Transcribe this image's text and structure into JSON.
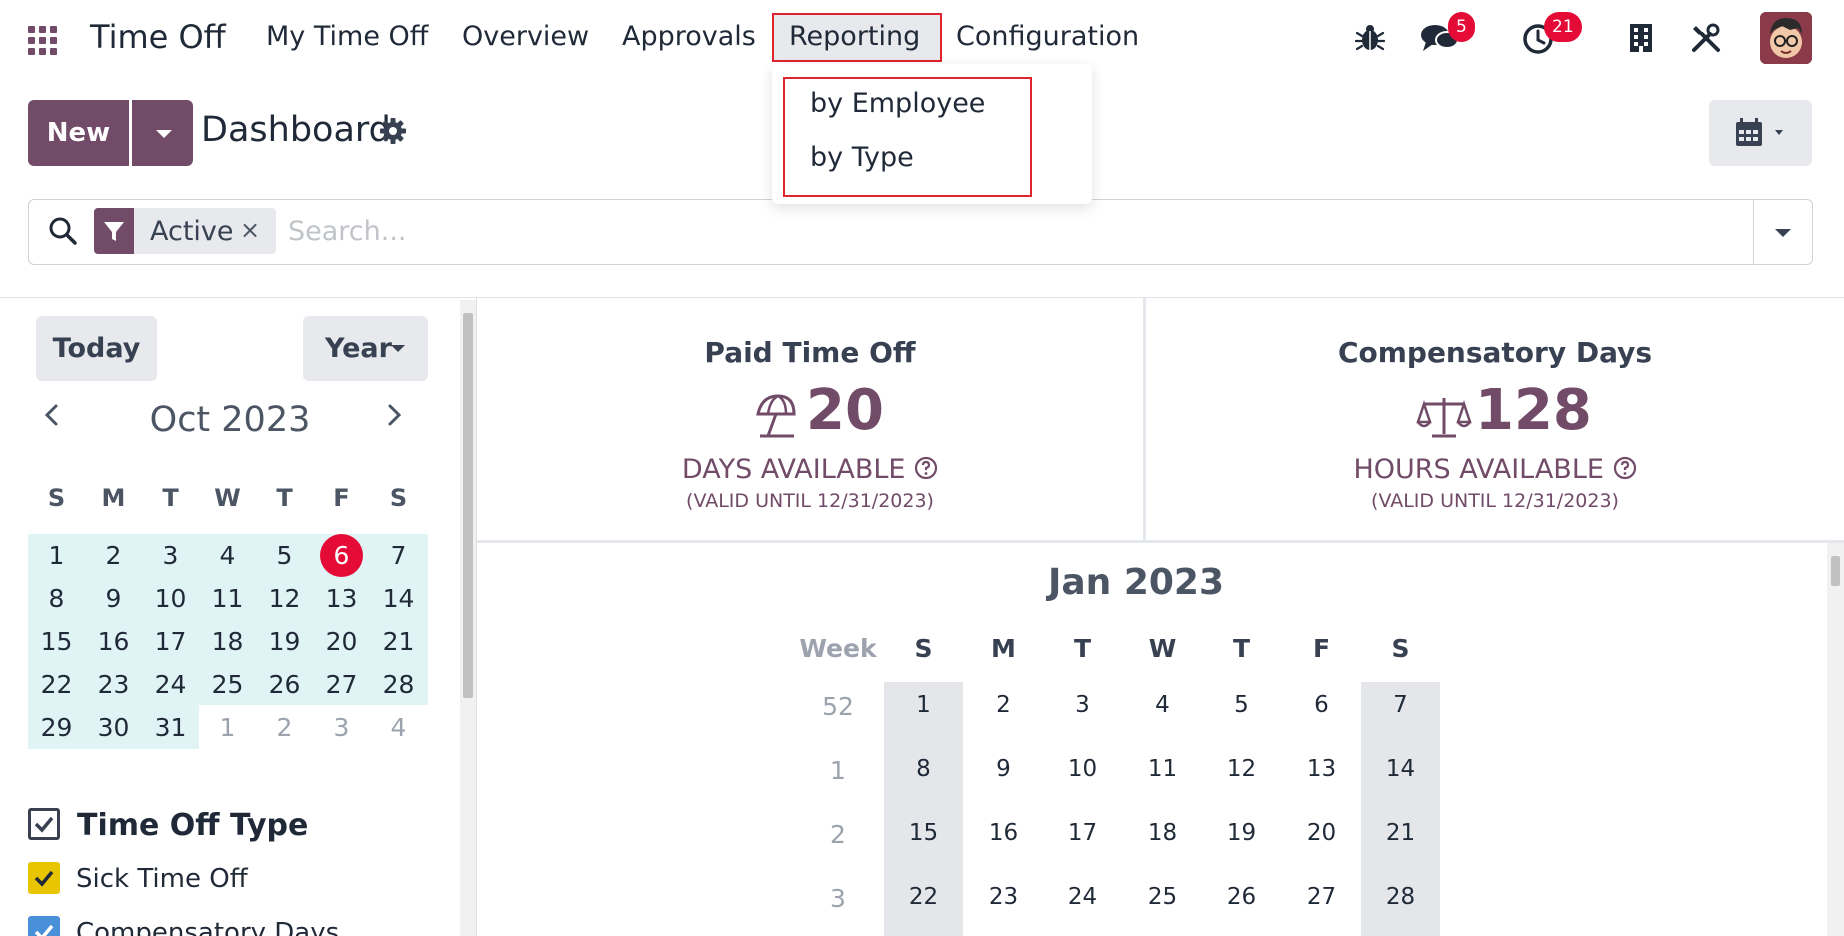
{
  "navbar": {
    "brand": "Time Off",
    "menu": [
      "My Time Off",
      "Overview",
      "Approvals",
      "Reporting",
      "Configuration"
    ],
    "messages_count": "5",
    "activities_count": "21"
  },
  "reporting_menu": {
    "items": [
      "by Employee",
      "by Type"
    ]
  },
  "control_panel": {
    "new_label": "New",
    "title": "Dashboard"
  },
  "search": {
    "facet": "Active",
    "facet_remove": "×",
    "placeholder": "Search..."
  },
  "mini_calendar": {
    "today_label": "Today",
    "scale_label": "Year",
    "month_label": "Oct 2023",
    "weekdays": [
      "S",
      "M",
      "T",
      "W",
      "T",
      "F",
      "S"
    ],
    "rows": [
      [
        "1",
        "2",
        "3",
        "4",
        "5",
        "6",
        "7"
      ],
      [
        "8",
        "9",
        "10",
        "11",
        "12",
        "13",
        "14"
      ],
      [
        "15",
        "16",
        "17",
        "18",
        "19",
        "20",
        "21"
      ],
      [
        "22",
        "23",
        "24",
        "25",
        "26",
        "27",
        "28"
      ],
      [
        "29",
        "30",
        "31",
        "1",
        "2",
        "3",
        "4"
      ]
    ],
    "today": "6"
  },
  "filters": {
    "heading": "Time Off Type",
    "items": [
      {
        "label": "Sick Time Off",
        "color": "#e9c400"
      },
      {
        "label": "Compensatory Days",
        "color": "#4a90d9"
      }
    ]
  },
  "stats": [
    {
      "name": "Paid Time Off",
      "value": "20",
      "unit": "DAYS AVAILABLE",
      "valid": "(VALID UNTIL 12/31/2023)",
      "icon": "umbrella-beach-icon"
    },
    {
      "name": "Compensatory Days",
      "value": "128",
      "unit": "HOURS AVAILABLE",
      "valid": "(VALID UNTIL 12/31/2023)",
      "icon": "balance-scale-icon"
    }
  ],
  "year_calendar": {
    "month_label": "Jan 2023",
    "week_header": "Week",
    "weekdays": [
      "S",
      "M",
      "T",
      "W",
      "T",
      "F",
      "S"
    ],
    "rows": [
      {
        "week": "52",
        "days": [
          "1",
          "2",
          "3",
          "4",
          "5",
          "6",
          "7"
        ]
      },
      {
        "week": "1",
        "days": [
          "8",
          "9",
          "10",
          "11",
          "12",
          "13",
          "14"
        ]
      },
      {
        "week": "2",
        "days": [
          "15",
          "16",
          "17",
          "18",
          "19",
          "20",
          "21"
        ]
      },
      {
        "week": "3",
        "days": [
          "22",
          "23",
          "24",
          "25",
          "26",
          "27",
          "28"
        ]
      }
    ]
  },
  "colors": {
    "brand": "#714B67",
    "highlight_border": "#e0232e",
    "badge": "#e40b36"
  }
}
